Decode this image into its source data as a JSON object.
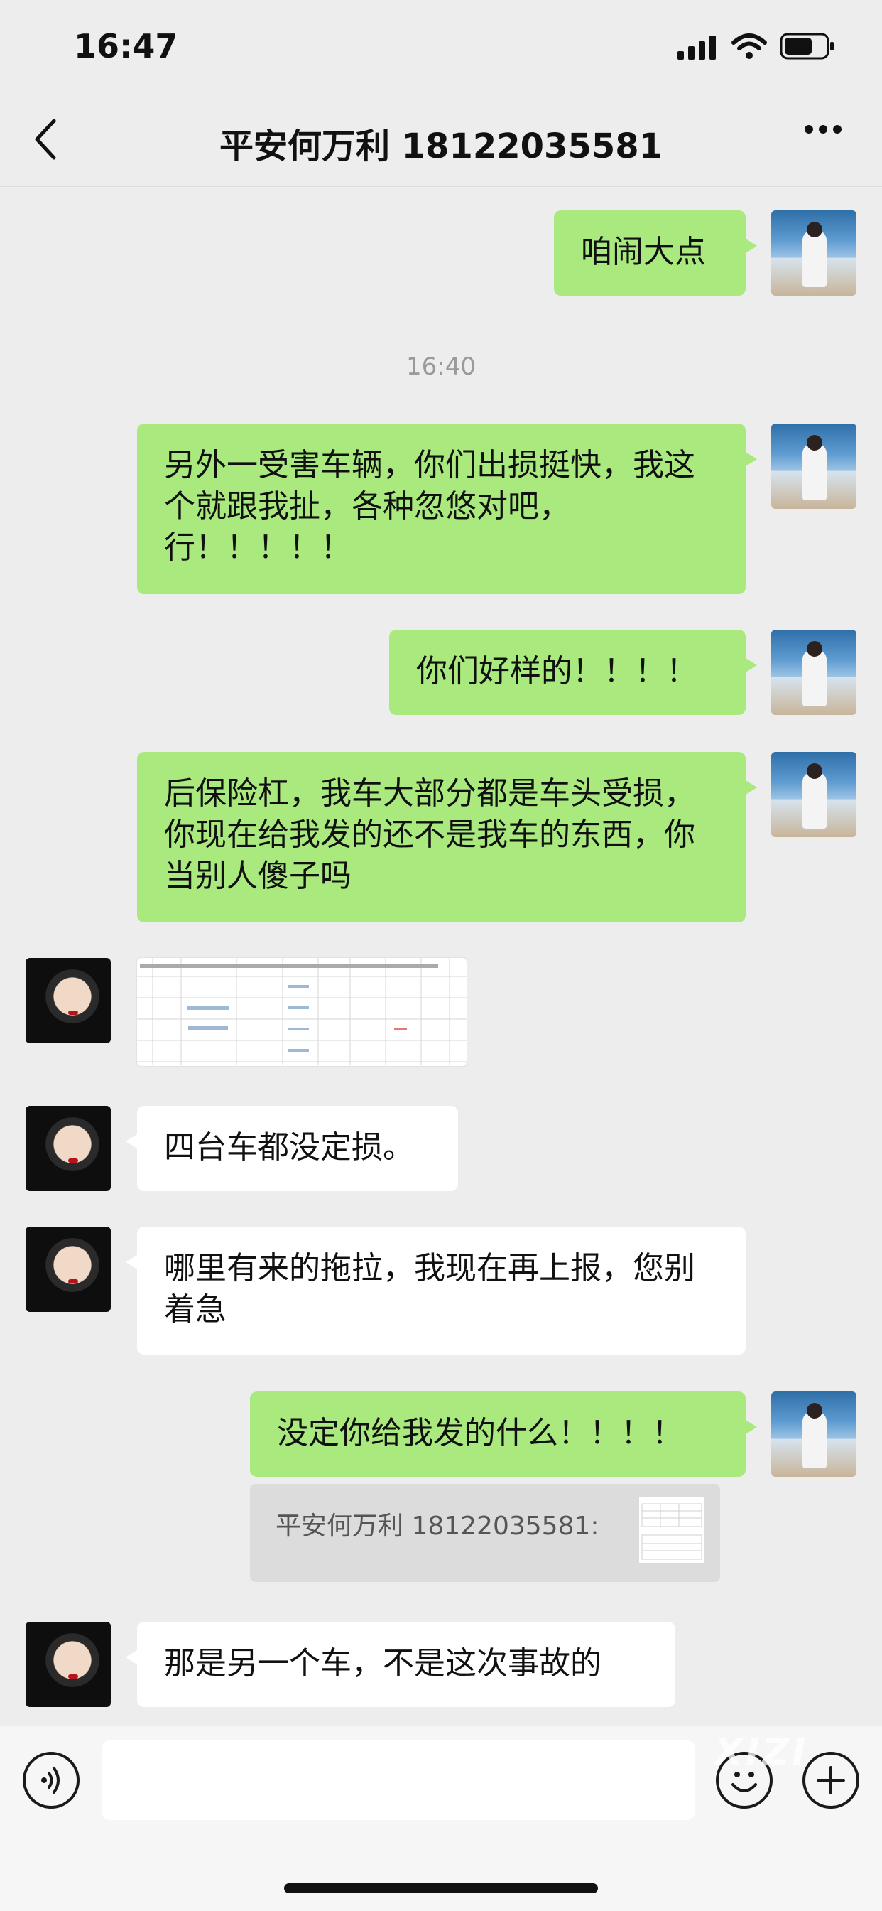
{
  "status_bar": {
    "time": "16:47"
  },
  "nav": {
    "title": "平安何万利 18122035581"
  },
  "timestamp": "16:40",
  "messages": [
    {
      "from": "me",
      "text": "咱闹大点"
    },
    {
      "from": "me",
      "text": "另外一受害车辆，你们出损挺快，我这个就跟我扯，各种忽悠对吧，行！！！！！"
    },
    {
      "from": "me",
      "text": "你们好样的！！！！"
    },
    {
      "from": "me",
      "text": "后保险杠，我车大部分都是车头受损，你现在给我发的还不是我车的东西，你当别人傻子吗"
    },
    {
      "from": "her",
      "type": "image",
      "text": ""
    },
    {
      "from": "her",
      "text": "四台车都没定损。"
    },
    {
      "from": "her",
      "text": "哪里有来的拖拉，我现在再上报，您别着急"
    },
    {
      "from": "me",
      "text": "没定你给我发的什么！！！！"
    },
    {
      "from": "her",
      "text": "那是另一个车，不是这次事故的"
    }
  ],
  "quote": {
    "text": "平安何万利 18122035581:"
  },
  "watermark": "XIZI",
  "colors": {
    "sent_bubble": "#a9e97d",
    "received_bubble": "#ffffff",
    "background": "#ededed"
  },
  "icons": [
    "back-chevron-icon",
    "more-dots-icon",
    "voice-icon",
    "emoji-icon",
    "plus-icon",
    "signal-icon",
    "wifi-icon",
    "battery-icon"
  ]
}
